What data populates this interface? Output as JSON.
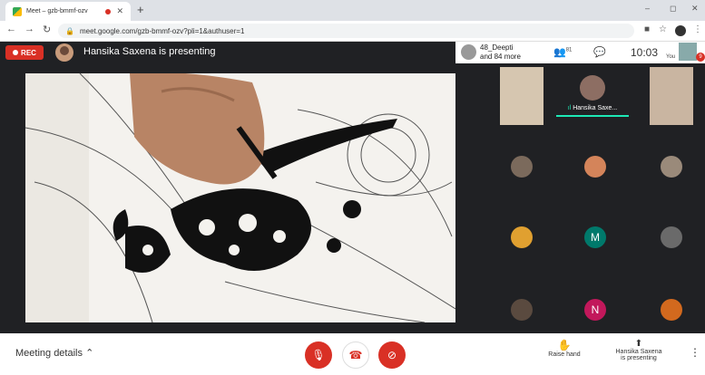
{
  "browser": {
    "tab_title": "Meet – gzb-bmmf-ozv",
    "new_tab": "+",
    "url": "meet.google.com/gzb-bmmf-ozv?pli=1&authuser=1",
    "window_min": "–",
    "window_max": "◻",
    "window_close": "✕"
  },
  "meeting": {
    "rec_label": "REC",
    "presenting_banner": "Hansika Saxena is presenting",
    "participants_summary_line1": "48_Deepti",
    "participants_summary_line2": "and 84 more",
    "people_count": "81",
    "clock": "10:03",
    "you_label": "You",
    "notif_count": "9",
    "speaker_name": "Hansika Saxe...",
    "tile_m": "M",
    "tile_n": "N"
  },
  "controls": {
    "meeting_details": "Meeting details",
    "raise_hand": "Raise hand",
    "presenting_line1": "Hansika Saxena",
    "presenting_line2": "is presenting"
  },
  "colors": {
    "red": "#d93025",
    "teal": "#00796b",
    "pink": "#c2185b",
    "active": "#1de9b6"
  }
}
